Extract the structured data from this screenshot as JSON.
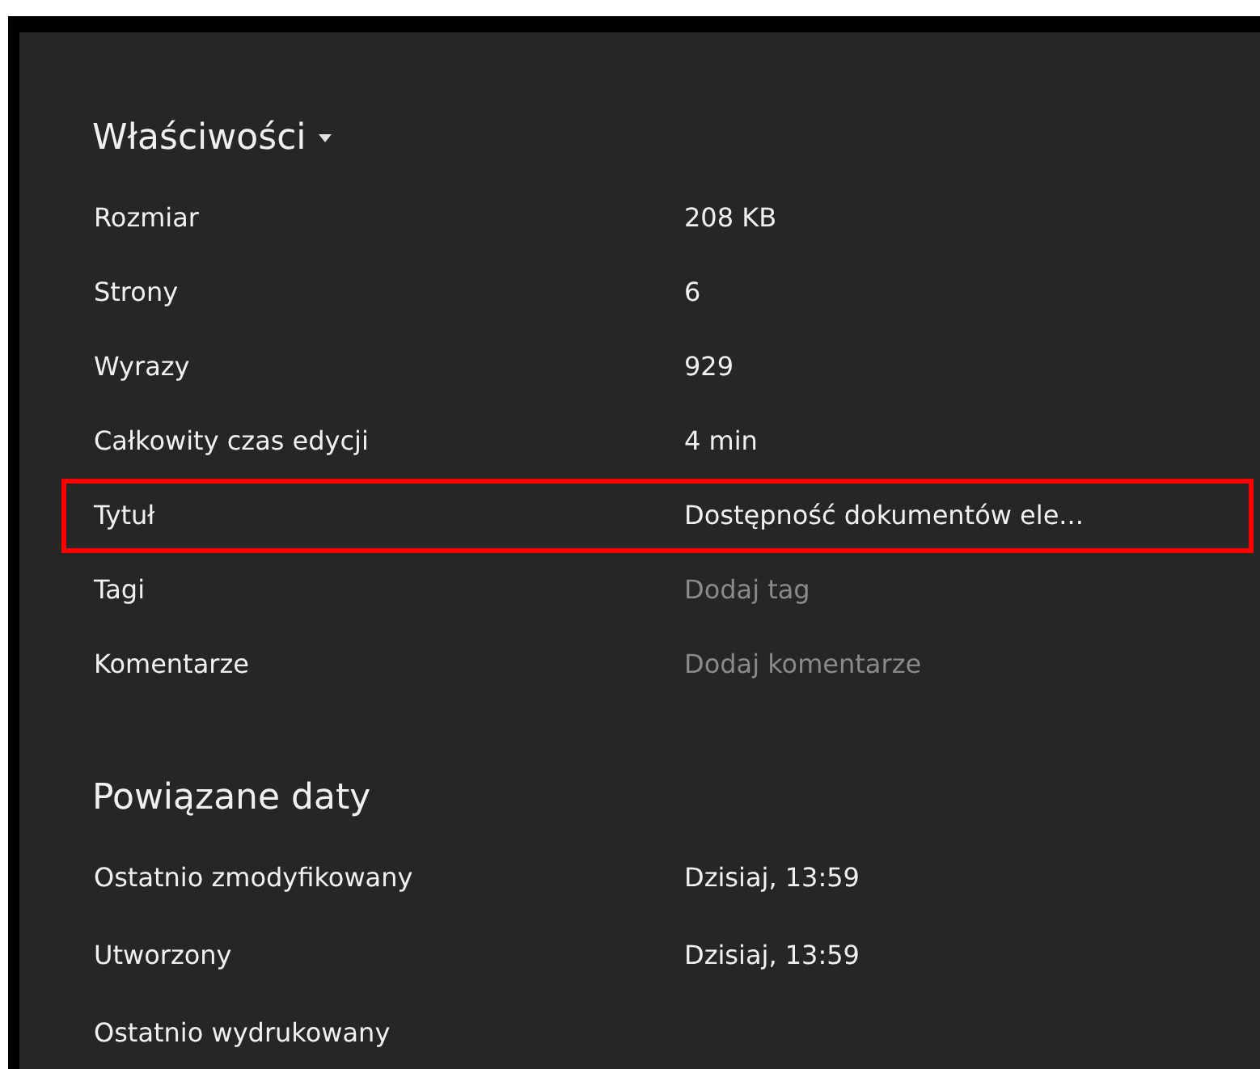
{
  "properties": {
    "title": "Właściwości",
    "rows": [
      {
        "label": "Rozmiar",
        "kind": "text",
        "value": "208 KB",
        "highlighted": false
      },
      {
        "label": "Strony",
        "kind": "text",
        "value": "6",
        "highlighted": false
      },
      {
        "label": "Wyrazy",
        "kind": "text",
        "value": "929",
        "highlighted": false
      },
      {
        "label": "Całkowity czas edycji",
        "kind": "text",
        "value": "4 min",
        "highlighted": false
      },
      {
        "label": "Tytuł",
        "kind": "text",
        "value": "Dostępność dokumentów ele...",
        "highlighted": true
      },
      {
        "label": "Tagi",
        "kind": "field",
        "placeholder": "Dodaj tag",
        "highlighted": false
      },
      {
        "label": "Komentarze",
        "kind": "field",
        "placeholder": "Dodaj komentarze",
        "highlighted": false
      }
    ]
  },
  "related_dates": {
    "title": "Powiązane daty",
    "rows": [
      {
        "label": "Ostatnio zmodyfikowany",
        "value": "Dzisiaj, 13:59"
      },
      {
        "label": "Utworzony",
        "value": "Dzisiaj, 13:59"
      },
      {
        "label": "Ostatnio wydrukowany"
      }
    ]
  }
}
